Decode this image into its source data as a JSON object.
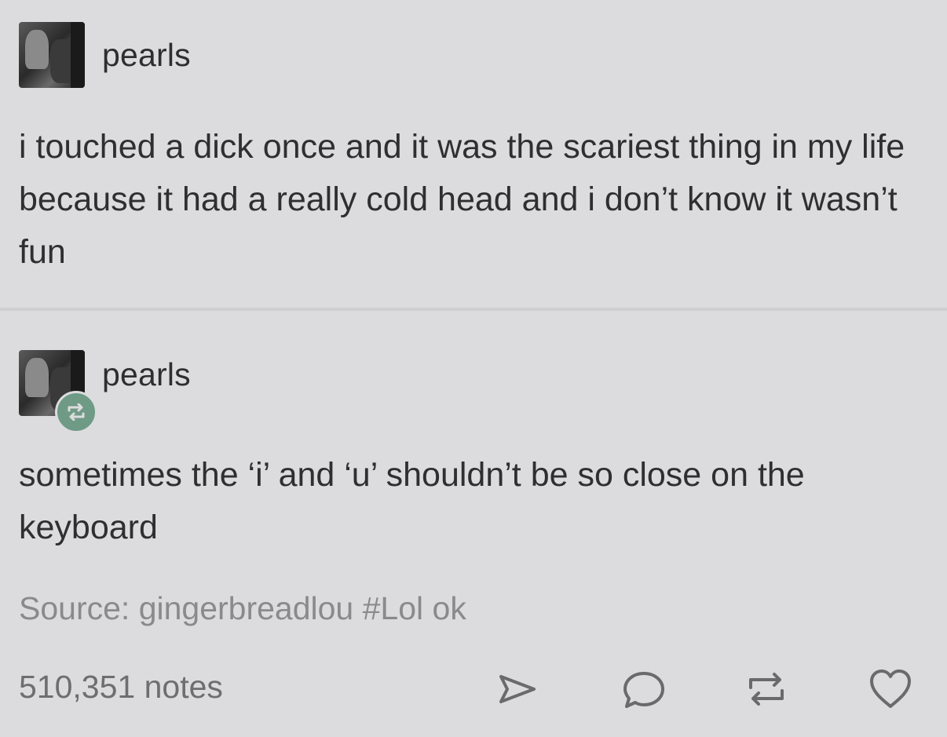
{
  "post": {
    "username": "pearls",
    "text": "i touched a dick once and it was the scariest thing in my life because it had a really cold head and i don’t know it wasn’t fun"
  },
  "reblog": {
    "username": "pearls",
    "text": "sometimes the ‘i’ and ‘u’ shouldn’t be so close on the keyboard"
  },
  "footer": {
    "source": "Source: gingerbreadlou #Lol ok",
    "notes": "510,351 notes"
  },
  "icons": {
    "share": "share-icon",
    "reply": "reply-icon",
    "reblog": "reblog-icon",
    "like": "heart-icon"
  },
  "colors": {
    "background": "#dcdcde",
    "reblog_badge": "#6f9a86"
  }
}
